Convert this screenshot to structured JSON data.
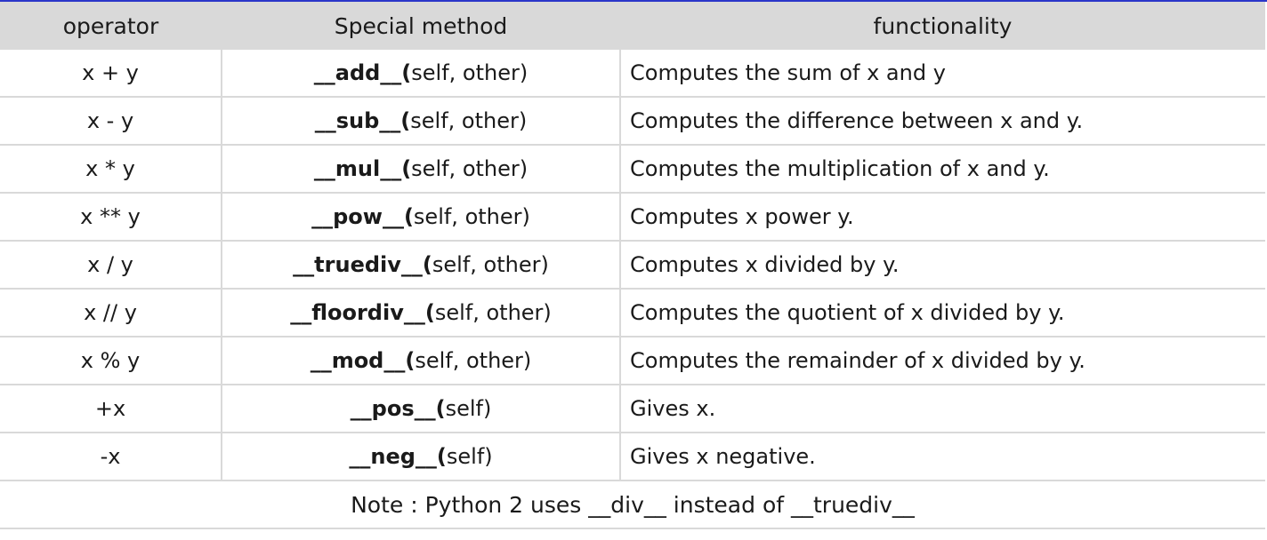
{
  "table": {
    "headers": [
      "operator",
      "Special method",
      "functionality"
    ],
    "rows": [
      {
        "operator": "x + y",
        "method_name": "__add__(",
        "method_args": "self, other)",
        "functionality": "Computes the sum of x and y"
      },
      {
        "operator": "x - y",
        "method_name": "__sub__(",
        "method_args": "self, other)",
        "functionality": "Computes the difference between x and y."
      },
      {
        "operator": "x * y",
        "method_name": "__mul__(",
        "method_args": "self, other)",
        "functionality": "Computes the multiplication of x and y."
      },
      {
        "operator": "x ** y",
        "method_name": "__pow__(",
        "method_args": "self, other)",
        "functionality": "Computes x power y."
      },
      {
        "operator": "x / y",
        "method_name": "__truediv__(",
        "method_args": "self, other)",
        "functionality": "Computes x divided by y."
      },
      {
        "operator": "x // y",
        "method_name": "__floordiv__(",
        "method_args": "self, other)",
        "functionality": "Computes the quotient of x divided by y."
      },
      {
        "operator": "x % y",
        "method_name": "__mod__(",
        "method_args": "self, other)",
        "functionality": "Computes the remainder of x divided by y."
      },
      {
        "operator": "+x",
        "method_name": "__pos__(",
        "method_args": "self)",
        "functionality": "Gives x."
      },
      {
        "operator": "-x",
        "method_name": "__neg__(",
        "method_args": "self)",
        "functionality": "Gives x negative."
      }
    ],
    "note": "Note : Python 2 uses __div__ instead of __truediv__"
  },
  "colors": {
    "header_bg": "#d9d9d9",
    "grid_line": "#d9d9d9",
    "top_rule": "#2a36c9"
  }
}
